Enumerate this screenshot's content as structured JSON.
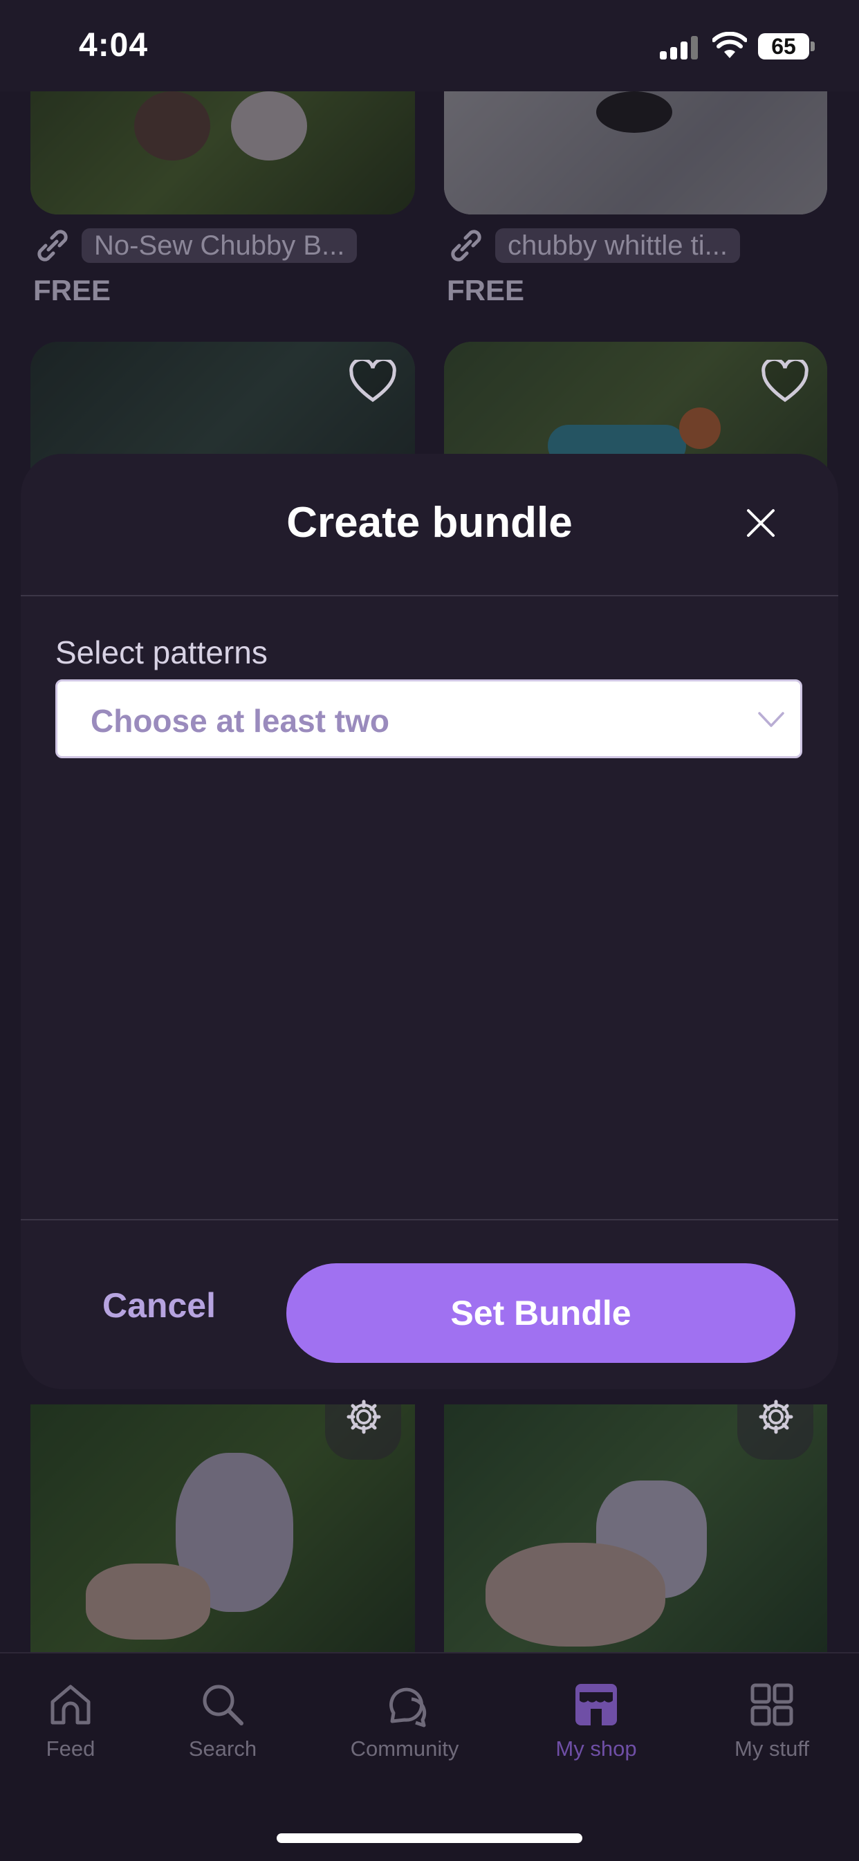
{
  "status_bar": {
    "time": "4:04",
    "battery": "65"
  },
  "feed": {
    "items": [
      {
        "pattern_name": "No-Sew Chubby B...",
        "price": "FREE"
      },
      {
        "pattern_name": "chubby whittle ti...",
        "price": "FREE"
      }
    ]
  },
  "modal": {
    "title": "Create bundle",
    "select_label": "Select patterns",
    "select_placeholder": "Choose at least two",
    "cancel_label": "Cancel",
    "submit_label": "Set Bundle"
  },
  "tab_bar": {
    "tabs": [
      {
        "label": "Feed",
        "icon": "home-icon"
      },
      {
        "label": "Search",
        "icon": "search-icon"
      },
      {
        "label": "Community",
        "icon": "chat-bubbles-icon"
      },
      {
        "label": "My shop",
        "icon": "storefront-icon",
        "active": true
      },
      {
        "label": "My stuff",
        "icon": "grid-icon"
      }
    ]
  },
  "colors": {
    "accent": "#a071f1",
    "active_tab": "#6f4fa6",
    "sheet_background": "#221c2c",
    "placeholder_text": "#9a8bbd"
  }
}
